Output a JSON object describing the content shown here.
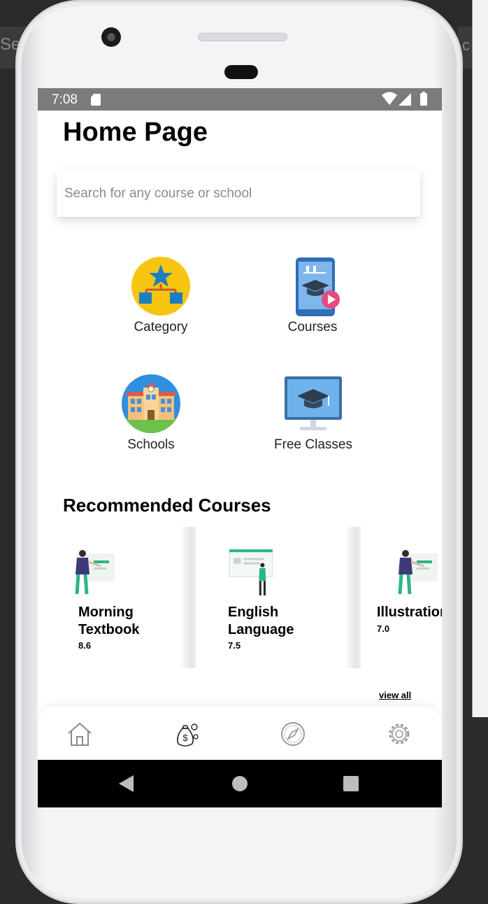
{
  "ide": {
    "left_fragment": "Se",
    "right_fragment": "c"
  },
  "status_bar": {
    "time": "7:08"
  },
  "page": {
    "title": "Home Page"
  },
  "search": {
    "placeholder": "Search for any course or school",
    "value": ""
  },
  "categories": [
    {
      "label": "Category",
      "icon": "category-hierarchy-icon"
    },
    {
      "label": "Courses",
      "icon": "courses-tablet-icon"
    },
    {
      "label": "Schools",
      "icon": "school-building-icon"
    },
    {
      "label": "Free Classes",
      "icon": "free-classes-monitor-icon"
    }
  ],
  "recommended": {
    "title": "Recommended Courses",
    "courses": [
      {
        "name": "Morning Textbook",
        "rating": "8.6"
      },
      {
        "name": "English Language",
        "rating": "7.5"
      },
      {
        "name": "Illustration",
        "rating": "7.0"
      }
    ],
    "view_all": "view all"
  },
  "bottom_nav": [
    {
      "icon": "home-icon"
    },
    {
      "icon": "money-bag-icon"
    },
    {
      "icon": "compass-icon"
    },
    {
      "icon": "gear-icon"
    }
  ],
  "colors": {
    "status_bar": "#7b7b7b",
    "category_yellow": "#f7c511",
    "icon_blue": "#1c8adb",
    "accent_green": "#2bb58c"
  }
}
